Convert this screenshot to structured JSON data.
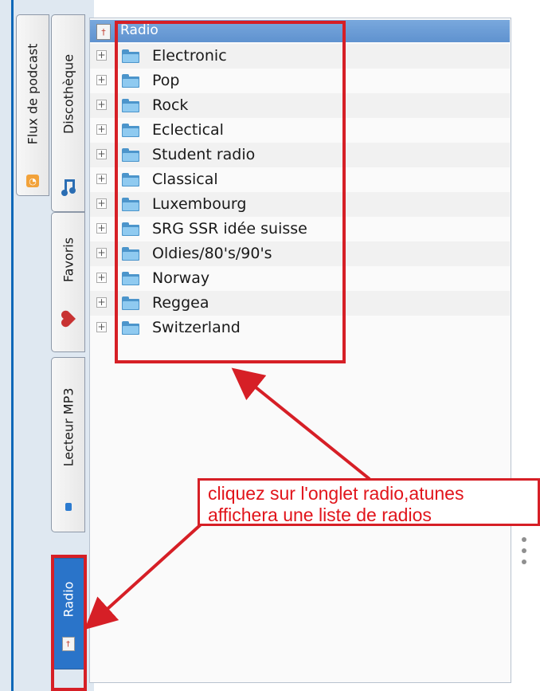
{
  "sidebar": {
    "tabs": [
      {
        "label": "Flux de podcast",
        "icon": "podcast-icon"
      },
      {
        "label": "Discothèque",
        "icon": "music-note-icon"
      },
      {
        "label": "Favoris",
        "icon": "heart-icon"
      },
      {
        "label": "Lecteur MP3",
        "icon": "mp3-player-icon"
      },
      {
        "label": "Radio",
        "icon": "radio-icon",
        "active": true
      }
    ]
  },
  "tree": {
    "header": "Radio",
    "items": [
      {
        "label": "Electronic"
      },
      {
        "label": "Pop"
      },
      {
        "label": "Rock"
      },
      {
        "label": "Eclectical"
      },
      {
        "label": "Student radio"
      },
      {
        "label": "Classical"
      },
      {
        "label": "Luxembourg"
      },
      {
        "label": "SRG SSR idée suisse"
      },
      {
        "label": "Oldies/80's/90's"
      },
      {
        "label": "Norway"
      },
      {
        "label": "Reggea"
      },
      {
        "label": "Switzerland"
      }
    ],
    "expander_glyph": "+"
  },
  "annotation": {
    "line1": "cliquez sur l'onglet radio,atunes",
    "line2": "affichera une liste de radios",
    "color": "#d61f26"
  }
}
